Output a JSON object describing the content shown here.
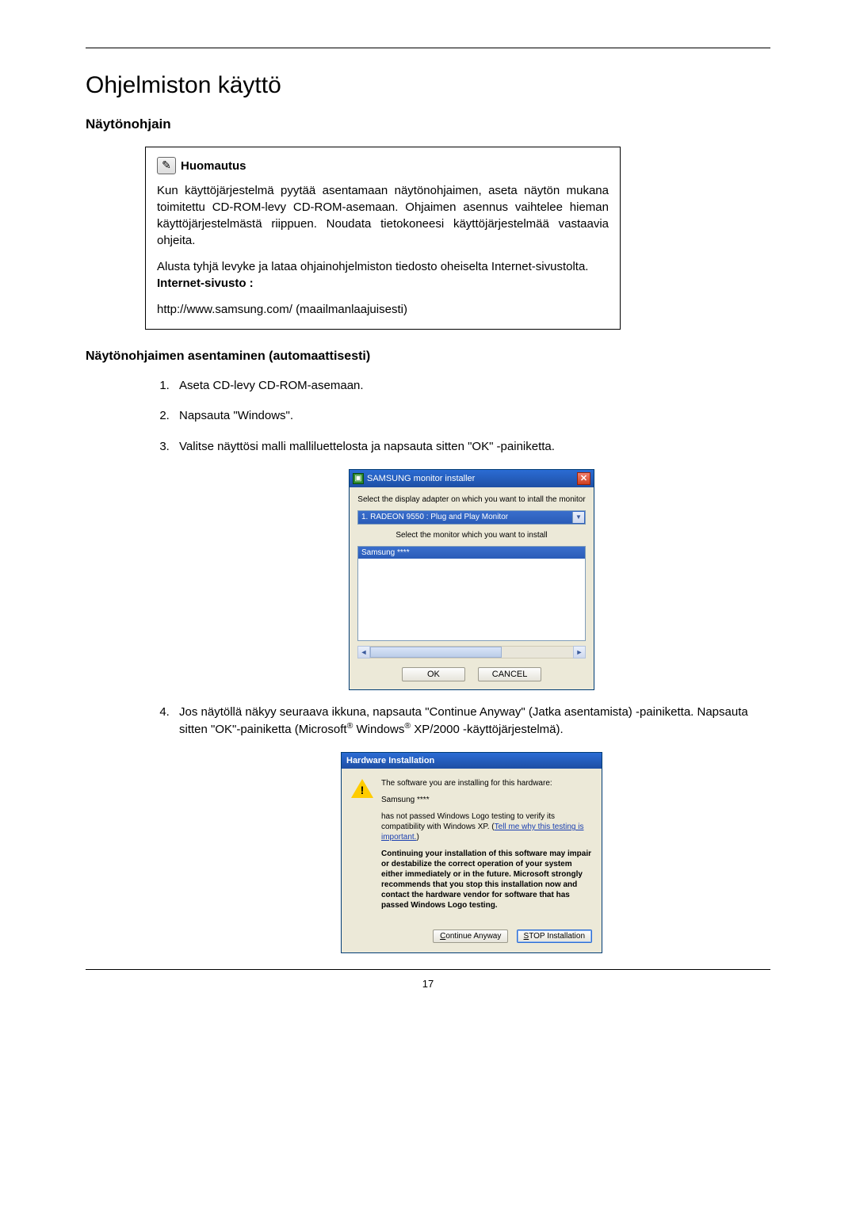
{
  "page_title": "Ohjelmiston käyttö",
  "subheading": "Näytönohjain",
  "note": {
    "label": "Huomautus",
    "p1": "Kun käyttöjärjestelmä pyytää asentamaan näytönohjaimen, aseta näytön mukana toimitettu CD-ROM-levy CD-ROM-asemaan. Ohjaimen asennus vaihtelee hieman käyttöjärjestelmästä riippuen. Noudata tietokoneesi käyttöjärjestelmää vastaavia ohjeita.",
    "p2": "Alusta tyhjä levyke ja lataa ohjainohjelmiston tiedosto oheiselta Internet-sivustolta.",
    "website_label": "Internet-sivusto :",
    "url": "http://www.samsung.com/ (maailmanlaajuisesti)"
  },
  "section_head": "Näytönohjaimen asentaminen (automaattisesti)",
  "steps": [
    "Aseta CD-levy CD-ROM-asemaan.",
    "Napsauta \"Windows\".",
    "Valitse näyttösi malli malliluettelosta ja napsauta sitten \"OK\" -painiketta."
  ],
  "step4": {
    "prefix": "Jos näytöllä näkyy seuraava ikkuna, napsauta \"Continue Anyway\" (Jatka asentamista) -painiketta. Napsauta sitten \"OK\"-painiketta (Microsoft",
    "mid": " Windows",
    "suffix": " XP/2000 -käyttöjärjestelmä)."
  },
  "installer": {
    "title": "SAMSUNG monitor installer",
    "instr1": "Select the display adapter on which you want to intall the monitor",
    "select_value": "1. RADEON 9550 : Plug and Play Monitor",
    "instr2": "Select the monitor which you want to install",
    "list_selected": "Samsung ****",
    "ok": "OK",
    "cancel": "CANCEL"
  },
  "warning": {
    "title": "Hardware Installation",
    "line1": "The software you are installing for this hardware:",
    "device": "Samsung ****",
    "line2_a": "has not passed Windows Logo testing to verify its compatibility with Windows XP. (",
    "link": "Tell me why this testing is important.",
    "line2_b": ")",
    "bold": "Continuing your installation of this software may impair or destabilize the correct operation of your system either immediately or in the future. Microsoft strongly recommends that you stop this installation now and contact the hardware vendor for software that has passed Windows Logo testing.",
    "continue": "Continue Anyway",
    "stop": "STOP Installation"
  },
  "page_number": "17"
}
